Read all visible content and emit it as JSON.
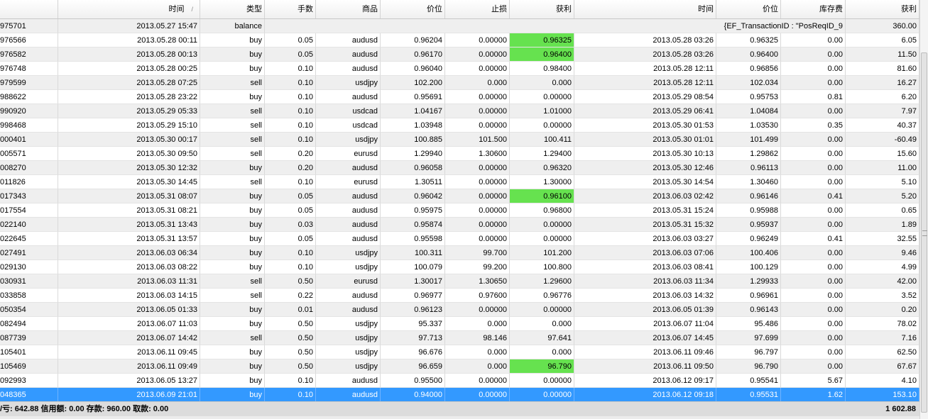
{
  "headers": {
    "open_time": "时间",
    "type": "类型",
    "lots": "手数",
    "symbol": "商品",
    "open_price": "价位",
    "stop_loss": "止损",
    "take_profit": "获利",
    "close_time": "时间",
    "close_price": "价位",
    "swap": "库存费",
    "profit": "获利",
    "sort_indicator": "/"
  },
  "colors": {
    "highlight": "#66e24f",
    "selected": "#3399ff"
  },
  "rows": [
    {
      "ticket": "975701",
      "open_time": "2013.05.27 15:47",
      "type": "balance",
      "comment": "{EF_TransactionID : \"PosReqID_9",
      "profit": "360.00"
    },
    {
      "ticket": "976566",
      "open_time": "2013.05.28 00:11",
      "type": "buy",
      "lots": "0.05",
      "symbol": "audusd",
      "open_price": "0.96204",
      "sl": "0.00000",
      "tp": "0.96325",
      "tp_hl": true,
      "close_time": "2013.05.28 03:26",
      "close_price": "0.96325",
      "swap": "0.00",
      "profit": "6.05"
    },
    {
      "ticket": "976582",
      "open_time": "2013.05.28 00:13",
      "type": "buy",
      "lots": "0.05",
      "symbol": "audusd",
      "open_price": "0.96170",
      "sl": "0.00000",
      "tp": "0.96400",
      "tp_hl": true,
      "close_time": "2013.05.28 03:26",
      "close_price": "0.96400",
      "swap": "0.00",
      "profit": "11.50"
    },
    {
      "ticket": "976748",
      "open_time": "2013.05.28 00:25",
      "type": "buy",
      "lots": "0.10",
      "symbol": "audusd",
      "open_price": "0.96040",
      "sl": "0.00000",
      "tp": "0.98400",
      "close_time": "2013.05.28 12:11",
      "close_price": "0.96856",
      "swap": "0.00",
      "profit": "81.60"
    },
    {
      "ticket": "979599",
      "open_time": "2013.05.28 07:25",
      "type": "sell",
      "lots": "0.10",
      "symbol": "usdjpy",
      "open_price": "102.200",
      "sl": "0.000",
      "tp": "0.000",
      "close_time": "2013.05.28 12:11",
      "close_price": "102.034",
      "swap": "0.00",
      "profit": "16.27"
    },
    {
      "ticket": "988622",
      "open_time": "2013.05.28 23:22",
      "type": "buy",
      "lots": "0.10",
      "symbol": "audusd",
      "open_price": "0.95691",
      "sl": "0.00000",
      "tp": "0.00000",
      "close_time": "2013.05.29 08:54",
      "close_price": "0.95753",
      "swap": "0.81",
      "profit": "6.20"
    },
    {
      "ticket": "990920",
      "open_time": "2013.05.29 05:33",
      "type": "sell",
      "lots": "0.10",
      "symbol": "usdcad",
      "open_price": "1.04167",
      "sl": "0.00000",
      "tp": "1.01000",
      "close_time": "2013.05.29 06:41",
      "close_price": "1.04084",
      "swap": "0.00",
      "profit": "7.97"
    },
    {
      "ticket": "998468",
      "open_time": "2013.05.29 15:10",
      "type": "sell",
      "lots": "0.10",
      "symbol": "usdcad",
      "open_price": "1.03948",
      "sl": "0.00000",
      "tp": "0.00000",
      "close_time": "2013.05.30 01:53",
      "close_price": "1.03530",
      "swap": "0.35",
      "profit": "40.37"
    },
    {
      "ticket": "000401",
      "open_time": "2013.05.30 00:17",
      "type": "sell",
      "lots": "0.10",
      "symbol": "usdjpy",
      "open_price": "100.885",
      "sl": "101.500",
      "tp": "100.411",
      "close_time": "2013.05.30 01:01",
      "close_price": "101.499",
      "swap": "0.00",
      "profit": "-60.49"
    },
    {
      "ticket": "005571",
      "open_time": "2013.05.30 09:50",
      "type": "sell",
      "lots": "0.20",
      "symbol": "eurusd",
      "open_price": "1.29940",
      "sl": "1.30600",
      "tp": "1.29400",
      "close_time": "2013.05.30 10:13",
      "close_price": "1.29862",
      "swap": "0.00",
      "profit": "15.60"
    },
    {
      "ticket": "008270",
      "open_time": "2013.05.30 12:32",
      "type": "buy",
      "lots": "0.20",
      "symbol": "audusd",
      "open_price": "0.96058",
      "sl": "0.00000",
      "tp": "0.96320",
      "close_time": "2013.05.30 12:46",
      "close_price": "0.96113",
      "swap": "0.00",
      "profit": "11.00"
    },
    {
      "ticket": "011826",
      "open_time": "2013.05.30 14:45",
      "type": "sell",
      "lots": "0.10",
      "symbol": "eurusd",
      "open_price": "1.30511",
      "sl": "0.00000",
      "tp": "1.30000",
      "close_time": "2013.05.30 14:54",
      "close_price": "1.30460",
      "swap": "0.00",
      "profit": "5.10"
    },
    {
      "ticket": "017343",
      "open_time": "2013.05.31 08:07",
      "type": "buy",
      "lots": "0.05",
      "symbol": "audusd",
      "open_price": "0.96042",
      "sl": "0.00000",
      "tp": "0.96100",
      "tp_hl": true,
      "close_time": "2013.06.03 02:42",
      "close_price": "0.96146",
      "swap": "0.41",
      "profit": "5.20"
    },
    {
      "ticket": "017554",
      "open_time": "2013.05.31 08:21",
      "type": "buy",
      "lots": "0.05",
      "symbol": "audusd",
      "open_price": "0.95975",
      "sl": "0.00000",
      "tp": "0.96800",
      "close_time": "2013.05.31 15:24",
      "close_price": "0.95988",
      "swap": "0.00",
      "profit": "0.65"
    },
    {
      "ticket": "022140",
      "open_time": "2013.05.31 13:43",
      "type": "buy",
      "lots": "0.03",
      "symbol": "audusd",
      "open_price": "0.95874",
      "sl": "0.00000",
      "tp": "0.00000",
      "close_time": "2013.05.31 15:32",
      "close_price": "0.95937",
      "swap": "0.00",
      "profit": "1.89"
    },
    {
      "ticket": "022645",
      "open_time": "2013.05.31 13:57",
      "type": "buy",
      "lots": "0.05",
      "symbol": "audusd",
      "open_price": "0.95598",
      "sl": "0.00000",
      "tp": "0.00000",
      "close_time": "2013.06.03 03:27",
      "close_price": "0.96249",
      "swap": "0.41",
      "profit": "32.55"
    },
    {
      "ticket": "027491",
      "open_time": "2013.06.03 06:34",
      "type": "buy",
      "lots": "0.10",
      "symbol": "usdjpy",
      "open_price": "100.311",
      "sl": "99.700",
      "tp": "101.200",
      "close_time": "2013.06.03 07:06",
      "close_price": "100.406",
      "swap": "0.00",
      "profit": "9.46"
    },
    {
      "ticket": "029130",
      "open_time": "2013.06.03 08:22",
      "type": "buy",
      "lots": "0.10",
      "symbol": "usdjpy",
      "open_price": "100.079",
      "sl": "99.200",
      "tp": "100.800",
      "close_time": "2013.06.03 08:41",
      "close_price": "100.129",
      "swap": "0.00",
      "profit": "4.99"
    },
    {
      "ticket": "030931",
      "open_time": "2013.06.03 11:31",
      "type": "sell",
      "lots": "0.50",
      "symbol": "eurusd",
      "open_price": "1.30017",
      "sl": "1.30650",
      "tp": "1.29600",
      "close_time": "2013.06.03 11:34",
      "close_price": "1.29933",
      "swap": "0.00",
      "profit": "42.00"
    },
    {
      "ticket": "033858",
      "open_time": "2013.06.03 14:15",
      "type": "sell",
      "lots": "0.22",
      "symbol": "audusd",
      "open_price": "0.96977",
      "sl": "0.97600",
      "tp": "0.96776",
      "close_time": "2013.06.03 14:32",
      "close_price": "0.96961",
      "swap": "0.00",
      "profit": "3.52"
    },
    {
      "ticket": "050354",
      "open_time": "2013.06.05 01:33",
      "type": "buy",
      "lots": "0.01",
      "symbol": "audusd",
      "open_price": "0.96123",
      "sl": "0.00000",
      "tp": "0.00000",
      "close_time": "2013.06.05 01:39",
      "close_price": "0.96143",
      "swap": "0.00",
      "profit": "0.20"
    },
    {
      "ticket": "082494",
      "open_time": "2013.06.07 11:03",
      "type": "buy",
      "lots": "0.50",
      "symbol": "usdjpy",
      "open_price": "95.337",
      "sl": "0.000",
      "tp": "0.000",
      "close_time": "2013.06.07 11:04",
      "close_price": "95.486",
      "swap": "0.00",
      "profit": "78.02"
    },
    {
      "ticket": "087739",
      "open_time": "2013.06.07 14:42",
      "type": "sell",
      "lots": "0.50",
      "symbol": "usdjpy",
      "open_price": "97.713",
      "sl": "98.146",
      "tp": "97.641",
      "close_time": "2013.06.07 14:45",
      "close_price": "97.699",
      "swap": "0.00",
      "profit": "7.16"
    },
    {
      "ticket": "105401",
      "open_time": "2013.06.11 09:45",
      "type": "buy",
      "lots": "0.50",
      "symbol": "usdjpy",
      "open_price": "96.676",
      "sl": "0.000",
      "tp": "0.000",
      "close_time": "2013.06.11 09:46",
      "close_price": "96.797",
      "swap": "0.00",
      "profit": "62.50"
    },
    {
      "ticket": "105469",
      "open_time": "2013.06.11 09:49",
      "type": "buy",
      "lots": "0.50",
      "symbol": "usdjpy",
      "open_price": "96.659",
      "sl": "0.000",
      "tp": "96.790",
      "tp_hl": true,
      "close_time": "2013.06.11 09:50",
      "close_price": "96.790",
      "swap": "0.00",
      "profit": "67.67"
    },
    {
      "ticket": "092993",
      "open_time": "2013.06.05 13:27",
      "type": "buy",
      "lots": "0.10",
      "symbol": "audusd",
      "open_price": "0.95500",
      "sl": "0.00000",
      "tp": "0.00000",
      "close_time": "2013.06.12 09:17",
      "close_price": "0.95541",
      "swap": "5.67",
      "profit": "4.10"
    },
    {
      "ticket": "048365",
      "open_time": "2013.06.09 21:01",
      "type": "buy",
      "lots": "0.10",
      "symbol": "audusd",
      "open_price": "0.94000",
      "sl": "0.00000",
      "tp": "0.00000",
      "close_time": "2013.06.12 09:18",
      "close_price": "0.95531",
      "swap": "1.62",
      "profit": "153.10",
      "selected": true
    }
  ],
  "footer": {
    "summary": "/亏: 642.88  信用额: 0.00  存款: 960.00  取款: 0.00",
    "total": "1 602.88"
  }
}
